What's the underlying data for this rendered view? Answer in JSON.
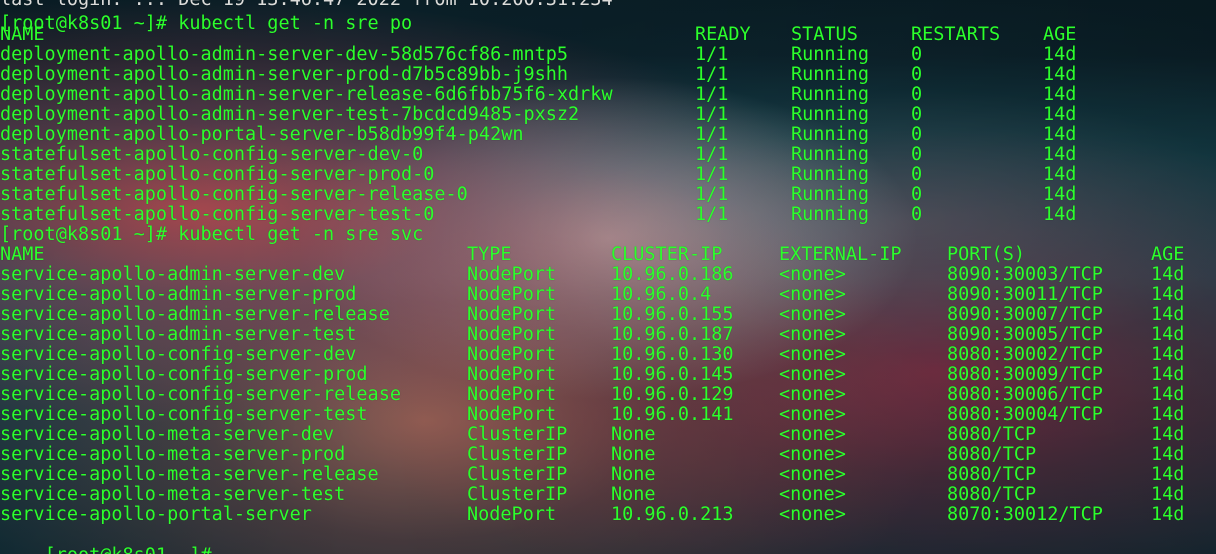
{
  "terminal": {
    "top_partial_line": "last login: ... Dec 19 13:46:47 2022 from 10.200.31.234",
    "pod_command": "[root@k8s01 ~]# kubectl get -n sre po",
    "pod_headers": [
      "NAME",
      "READY",
      "STATUS",
      "RESTARTS",
      "AGE"
    ],
    "pods": [
      {
        "name": "deployment-apollo-admin-server-dev-58d576cf86-mntp5",
        "ready": "1/1",
        "status": "Running",
        "restarts": "0",
        "age": "14d"
      },
      {
        "name": "deployment-apollo-admin-server-prod-d7b5c89bb-j9shh",
        "ready": "1/1",
        "status": "Running",
        "restarts": "0",
        "age": "14d"
      },
      {
        "name": "deployment-apollo-admin-server-release-6d6fbb75f6-xdrkw",
        "ready": "1/1",
        "status": "Running",
        "restarts": "0",
        "age": "14d"
      },
      {
        "name": "deployment-apollo-admin-server-test-7bcdcd9485-pxsz2",
        "ready": "1/1",
        "status": "Running",
        "restarts": "0",
        "age": "14d"
      },
      {
        "name": "deployment-apollo-portal-server-b58db99f4-p42wn",
        "ready": "1/1",
        "status": "Running",
        "restarts": "0",
        "age": "14d"
      },
      {
        "name": "statefulset-apollo-config-server-dev-0",
        "ready": "1/1",
        "status": "Running",
        "restarts": "0",
        "age": "14d"
      },
      {
        "name": "statefulset-apollo-config-server-prod-0",
        "ready": "1/1",
        "status": "Running",
        "restarts": "0",
        "age": "14d"
      },
      {
        "name": "statefulset-apollo-config-server-release-0",
        "ready": "1/1",
        "status": "Running",
        "restarts": "0",
        "age": "14d"
      },
      {
        "name": "statefulset-apollo-config-server-test-0",
        "ready": "1/1",
        "status": "Running",
        "restarts": "0",
        "age": "14d"
      }
    ],
    "svc_command": "[root@k8s01 ~]# kubectl get -n sre svc",
    "svc_headers": [
      "NAME",
      "TYPE",
      "CLUSTER-IP",
      "EXTERNAL-IP",
      "PORT(S)",
      "AGE"
    ],
    "services": [
      {
        "name": "service-apollo-admin-server-dev",
        "type": "NodePort",
        "cluster_ip": "10.96.0.186",
        "external_ip": "<none>",
        "ports": "8090:30003/TCP",
        "age": "14d"
      },
      {
        "name": "service-apollo-admin-server-prod",
        "type": "NodePort",
        "cluster_ip": "10.96.0.4",
        "external_ip": "<none>",
        "ports": "8090:30011/TCP",
        "age": "14d"
      },
      {
        "name": "service-apollo-admin-server-release",
        "type": "NodePort",
        "cluster_ip": "10.96.0.155",
        "external_ip": "<none>",
        "ports": "8090:30007/TCP",
        "age": "14d"
      },
      {
        "name": "service-apollo-admin-server-test",
        "type": "NodePort",
        "cluster_ip": "10.96.0.187",
        "external_ip": "<none>",
        "ports": "8090:30005/TCP",
        "age": "14d"
      },
      {
        "name": "service-apollo-config-server-dev",
        "type": "NodePort",
        "cluster_ip": "10.96.0.130",
        "external_ip": "<none>",
        "ports": "8080:30002/TCP",
        "age": "14d"
      },
      {
        "name": "service-apollo-config-server-prod",
        "type": "NodePort",
        "cluster_ip": "10.96.0.145",
        "external_ip": "<none>",
        "ports": "8080:30009/TCP",
        "age": "14d"
      },
      {
        "name": "service-apollo-config-server-release",
        "type": "NodePort",
        "cluster_ip": "10.96.0.129",
        "external_ip": "<none>",
        "ports": "8080:30006/TCP",
        "age": "14d"
      },
      {
        "name": "service-apollo-config-server-test",
        "type": "NodePort",
        "cluster_ip": "10.96.0.141",
        "external_ip": "<none>",
        "ports": "8080:30004/TCP",
        "age": "14d"
      },
      {
        "name": "service-apollo-meta-server-dev",
        "type": "ClusterIP",
        "cluster_ip": "None",
        "external_ip": "<none>",
        "ports": "8080/TCP",
        "age": "14d"
      },
      {
        "name": "service-apollo-meta-server-prod",
        "type": "ClusterIP",
        "cluster_ip": "None",
        "external_ip": "<none>",
        "ports": "8080/TCP",
        "age": "14d"
      },
      {
        "name": "service-apollo-meta-server-release",
        "type": "ClusterIP",
        "cluster_ip": "None",
        "external_ip": "<none>",
        "ports": "8080/TCP",
        "age": "14d"
      },
      {
        "name": "service-apollo-meta-server-test",
        "type": "ClusterIP",
        "cluster_ip": "None",
        "external_ip": "<none>",
        "ports": "8080/TCP",
        "age": "14d"
      },
      {
        "name": "service-apollo-portal-server",
        "type": "NodePort",
        "cluster_ip": "10.96.0.213",
        "external_ip": "<none>",
        "ports": "8070:30012/TCP",
        "age": "14d"
      }
    ],
    "prompt": "[root@k8s01 ~]#"
  },
  "colors": {
    "terminal_text": "#2cff2c"
  }
}
